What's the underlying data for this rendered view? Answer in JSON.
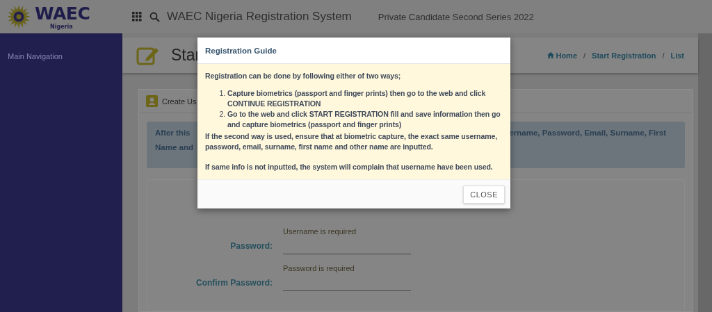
{
  "header": {
    "logo_text": "WAEC",
    "logo_subtext": "Nigeria",
    "title": "WAEC Nigeria Registration System",
    "subtitle": "Private Candidate Second Series 2022"
  },
  "sidebar": {
    "heading": "Main Navigation"
  },
  "page_header": {
    "title": "Star",
    "separator": "/",
    "breadcrumb": [
      {
        "label": "Home",
        "kind": "home"
      },
      {
        "label": "Start Registration",
        "kind": "link"
      },
      {
        "label": "List",
        "kind": "link"
      }
    ]
  },
  "card": {
    "title": "Create Us",
    "notice": {
      "left": [
        "After this",
        "Name and"
      ],
      "right": [
        "ername, Password, Email, Surname, First"
      ]
    },
    "form_rows": [
      {
        "kind": "message",
        "text": "Username is required"
      },
      {
        "kind": "field",
        "label": "Password:"
      },
      {
        "kind": "message",
        "text": "Password is required"
      },
      {
        "kind": "field",
        "label": "Confirm Password:"
      }
    ]
  },
  "modal": {
    "title": "Registration Guide",
    "intro": "Registration can be done by following either of two ways;",
    "steps": [
      {
        "marker": "1.",
        "text": "Capture biometrics (passport and finger prints) then go to the web and click CONTINUE REGISTRATION"
      },
      {
        "marker": "2.",
        "text": "Go to the web and click START REGISTRATION fill and save information then go and capture biometrics (passport and finger prints)"
      }
    ],
    "paragraphs": [
      "If the second way is used, ensure that at biometric capture, the exact same username, password, email, surname, first name and other name are inputted.",
      "If same info is not inputted, the system will complain that username have been used."
    ],
    "button": "CLOSE"
  }
}
